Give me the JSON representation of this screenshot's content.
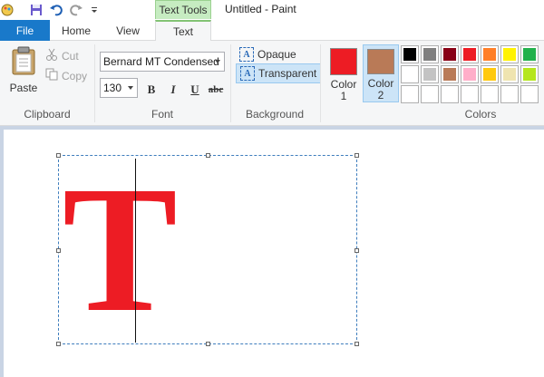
{
  "window": {
    "title": "Untitled - Paint",
    "context_tab_group": "Text Tools"
  },
  "quick_access": {
    "icons": [
      "paint-app-icon",
      "save-icon",
      "undo-icon",
      "redo-icon",
      "customize-qat-icon"
    ]
  },
  "tabs": {
    "file": "File",
    "home": "Home",
    "view": "View",
    "text": "Text"
  },
  "clipboard": {
    "paste": "Paste",
    "cut": "Cut",
    "copy": "Copy",
    "label": "Clipboard"
  },
  "font": {
    "family": "Bernard MT Condensed",
    "size": "130",
    "bold": "B",
    "italic": "I",
    "underline": "U",
    "strikethrough": "abc",
    "label": "Font"
  },
  "background": {
    "opaque": "Opaque",
    "transparent": "Transparent",
    "selected": "Transparent",
    "label": "Background"
  },
  "colors": {
    "color1_label_a": "Color",
    "color1_label_b": "1",
    "color1": "#ed1c24",
    "color2_label_a": "Color",
    "color2_label_b": "2",
    "color2": "#b97a57",
    "label": "Colors",
    "palette": [
      [
        "#000000",
        "#7f7f7f",
        "#880015",
        "#ed1c24",
        "#ff7f27",
        "#fff200",
        "#22b14c"
      ],
      [
        "#ffffff",
        "#c3c3c3",
        "#b97a57",
        "#ffaec9",
        "#ffc90e",
        "#efe4b0",
        "#b5e61d"
      ],
      [
        "",
        "",
        "",
        "",
        "",
        "",
        ""
      ]
    ]
  },
  "canvas": {
    "text": "T",
    "text_color": "#ed1c24"
  }
}
